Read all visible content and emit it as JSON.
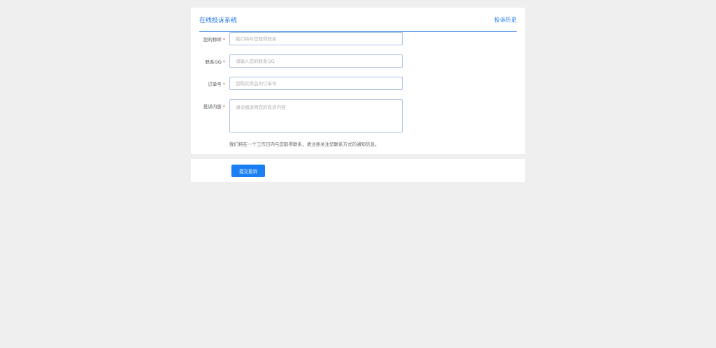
{
  "header": {
    "title": "在线投诉系统",
    "history_link": "投诉历史"
  },
  "form": {
    "required_mark": "*",
    "fields": [
      {
        "label": "您的称呼",
        "placeholder": "我们将与您取得联系",
        "value": ""
      },
      {
        "label": "联系QQ",
        "placeholder": "请输入您的联系QQ",
        "value": ""
      },
      {
        "label": "订单号",
        "placeholder": "您购买商品的订单号",
        "value": ""
      },
      {
        "label": "投诉内容",
        "placeholder": "请详细说明您的投诉内容",
        "value": ""
      }
    ],
    "notice": "我们将在一个工作日内与您取得联系，请注意关注您联系方式的通知信息。"
  },
  "submit": {
    "label": "提交投诉"
  },
  "colors": {
    "accent": "#1a7ef5",
    "required": "#e74c3c",
    "background": "#efefef"
  }
}
